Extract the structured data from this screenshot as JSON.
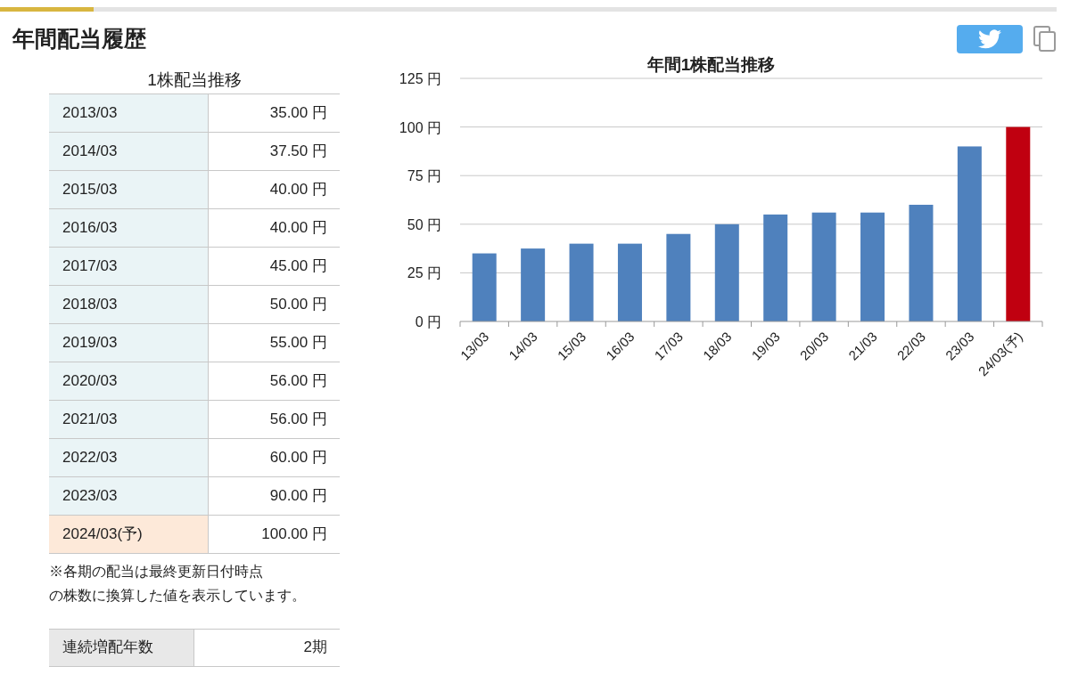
{
  "title": "年間配当履歴",
  "dividend_table": {
    "caption": "1株配当推移",
    "rows": [
      {
        "period": "2013/03",
        "amount": "35.00 円",
        "forecast": false
      },
      {
        "period": "2014/03",
        "amount": "37.50 円",
        "forecast": false
      },
      {
        "period": "2015/03",
        "amount": "40.00 円",
        "forecast": false
      },
      {
        "period": "2016/03",
        "amount": "40.00 円",
        "forecast": false
      },
      {
        "period": "2017/03",
        "amount": "45.00 円",
        "forecast": false
      },
      {
        "period": "2018/03",
        "amount": "50.00 円",
        "forecast": false
      },
      {
        "period": "2019/03",
        "amount": "55.00 円",
        "forecast": false
      },
      {
        "period": "2020/03",
        "amount": "56.00 円",
        "forecast": false
      },
      {
        "period": "2021/03",
        "amount": "56.00 円",
        "forecast": false
      },
      {
        "period": "2022/03",
        "amount": "60.00 円",
        "forecast": false
      },
      {
        "period": "2023/03",
        "amount": "90.00 円",
        "forecast": false
      },
      {
        "period": "2024/03(予)",
        "amount": "100.00 円",
        "forecast": true
      }
    ]
  },
  "note": [
    "※各期の配当は最終更新日付時点",
    "の株数に換算した値を表示しています。"
  ],
  "streak": {
    "label": "連続増配年数",
    "value": "2期"
  },
  "chart": {
    "chart_data": {
      "type": "bar",
      "title": "年間1株配当推移",
      "grid": true,
      "categories": [
        "13/03",
        "14/03",
        "15/03",
        "16/03",
        "17/03",
        "18/03",
        "19/03",
        "20/03",
        "21/03",
        "22/03",
        "23/03",
        "24/03(予)"
      ],
      "series": [
        {
          "color": "#4f81bd",
          "values": [
            35,
            37.5,
            40,
            40,
            45,
            50,
            55,
            56,
            56,
            60,
            90,
            null
          ]
        },
        {
          "color": "#c00010",
          "values": [
            null,
            null,
            null,
            null,
            null,
            null,
            null,
            null,
            null,
            null,
            null,
            100
          ]
        }
      ],
      "ylim": [
        0,
        125
      ],
      "yticks": [
        {
          "value": 0,
          "label": "0 円"
        },
        {
          "value": 25,
          "label": "25 円"
        },
        {
          "value": 50,
          "label": "50 円"
        },
        {
          "value": 75,
          "label": "75 円"
        },
        {
          "value": 100,
          "label": "100 円"
        },
        {
          "value": 125,
          "label": "125 円"
        }
      ]
    }
  }
}
